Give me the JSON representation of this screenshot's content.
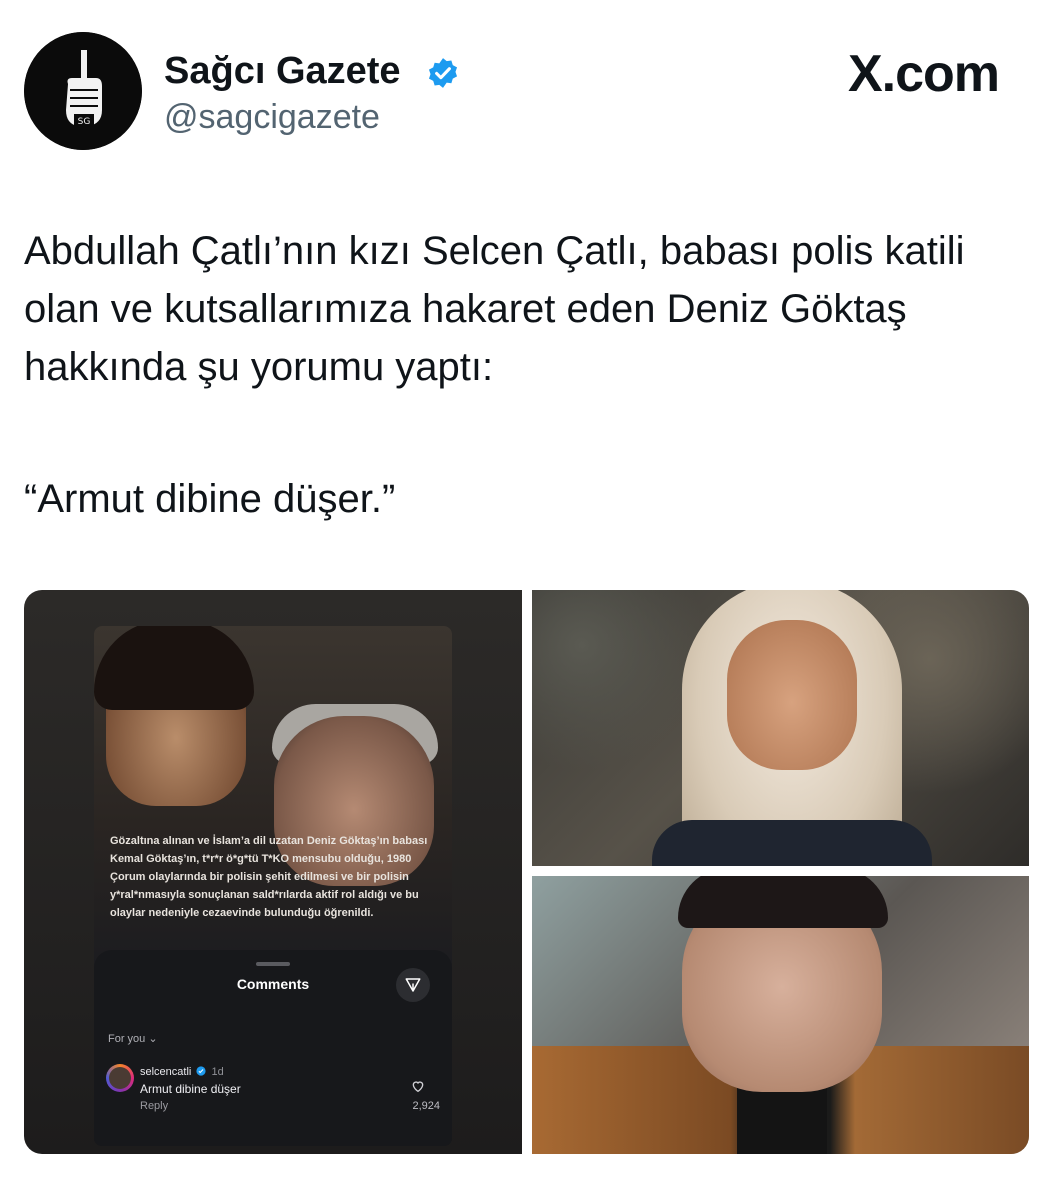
{
  "header": {
    "display_name": "Sağcı Gazete",
    "username": "@sagcigazete",
    "site": "X.com"
  },
  "tweet": {
    "text": "Abdullah Çatlı’nın kızı Selcen Çatlı, babası polis katili olan ve kutsallarımıza hakaret eden Deniz Göktaş hakkında şu yorumu yaptı:",
    "quote": "“Armut dibine düşer.”"
  },
  "screenshot": {
    "overlay_text": "Gözaltına alınan ve İslam’a dil uzatan Deniz Göktaş’ın babası Kemal Göktaş’ın, t*r*r ö*g*tü T*KO mensubu olduğu, 1980 Çorum olaylarında bir polisin şehit edilmesi ve bir polisin y*ral*nmasıyla sonuçlanan sald*rılarda aktif rol aldığı ve bu olaylar nedeniyle cezaevinde bulunduğu öğrenildi.",
    "comments_title": "Comments",
    "for_you": "For you",
    "comment": {
      "user": "selcencatli",
      "time": "1d",
      "text": "Armut dibine düşer",
      "reply": "Reply",
      "likes": "2,924"
    }
  },
  "colors": {
    "verified": "#1d9bf0",
    "text": "#0f1419",
    "muted": "#536471"
  }
}
